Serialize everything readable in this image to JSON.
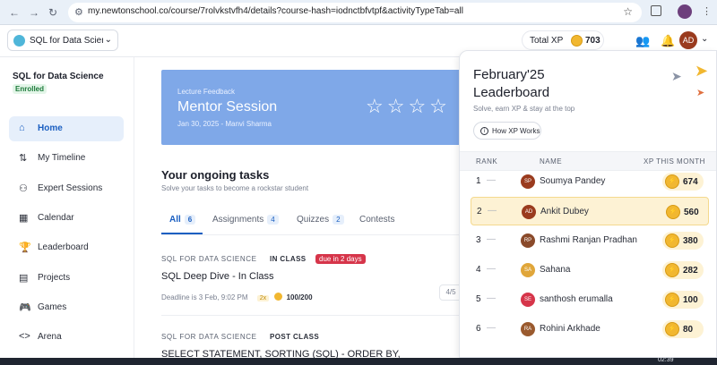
{
  "browser": {
    "url": "my.newtonschool.co/course/7rolvkstvfh4/details?course-hash=iodnctbfvtpf&activityTypeTab=all"
  },
  "header": {
    "course_select": "SQL for Data Scienc...",
    "total_xp_label": "Total XP",
    "total_xp_value": "703",
    "avatar_initials": "AD"
  },
  "sidebar": {
    "course_title": "SQL for Data Science",
    "status": "Enrolled",
    "items": [
      {
        "label": "Home",
        "icon": "home-icon"
      },
      {
        "label": "My Timeline",
        "icon": "timeline-icon"
      },
      {
        "label": "Expert Sessions",
        "icon": "people-icon"
      },
      {
        "label": "Calendar",
        "icon": "calendar-icon"
      },
      {
        "label": "Leaderboard",
        "icon": "trophy-icon"
      },
      {
        "label": "Projects",
        "icon": "document-icon"
      },
      {
        "label": "Games",
        "icon": "gamepad-icon"
      },
      {
        "label": "Arena",
        "icon": "code-icon"
      }
    ]
  },
  "banner": {
    "kicker": "Lecture Feedback",
    "title": "Mentor Session",
    "meta": "Jan 30, 2025 - Manvi Sharma"
  },
  "tasks": {
    "title": "Your ongoing tasks",
    "subtitle": "Solve your tasks to become a rockstar student",
    "tabs": [
      {
        "label": "All",
        "count": "6"
      },
      {
        "label": "Assignments",
        "count": "4"
      },
      {
        "label": "Quizzes",
        "count": "2"
      },
      {
        "label": "Contests",
        "count": ""
      }
    ],
    "items": [
      {
        "category": "SQL FOR DATA SCIENCE",
        "class_type": "IN CLASS",
        "due": "due in 2 days",
        "name": "SQL Deep Dive - In Class",
        "deadline": "Deadline is 3 Feb, 9:02 PM",
        "multiplier": "2x",
        "score": "100/200",
        "pager": "4/5"
      },
      {
        "category": "SQL FOR DATA SCIENCE",
        "class_type": "POST CLASS",
        "name": "SELECT STATEMENT, SORTING (SQL) - ORDER BY,"
      }
    ]
  },
  "leaderboard": {
    "title_line1": "February'25",
    "title_line2": "Leaderboard",
    "subtitle": "Solve, earn XP & stay at the top",
    "how_button": "How XP Works",
    "columns": {
      "rank": "RANK",
      "name": "NAME",
      "xp": "XP THIS MONTH"
    },
    "rows": [
      {
        "rank": "1",
        "initials": "SP",
        "name": "Soumya Pandey",
        "xp": "674",
        "avatar_color": "#9a3b1e"
      },
      {
        "rank": "2",
        "initials": "AD",
        "name": "Ankit Dubey",
        "xp": "560",
        "avatar_color": "#9a3b1e"
      },
      {
        "rank": "3",
        "initials": "RP",
        "name": "Rashmi Ranjan Pradhan",
        "xp": "380",
        "avatar_color": "#8a4a2a"
      },
      {
        "rank": "4",
        "initials": "SA",
        "name": "Sahana",
        "xp": "282",
        "avatar_color": "#e0a63a"
      },
      {
        "rank": "5",
        "initials": "SE",
        "name": "santhosh erumalla",
        "xp": "100",
        "avatar_color": "#d6354a"
      },
      {
        "rank": "6",
        "initials": "RA",
        "name": "Rohini Arkhade",
        "xp": "80",
        "avatar_color": "#9a5a2e"
      }
    ]
  },
  "taskbar": {
    "time": "02:39"
  },
  "colors": {
    "accent": "#1b5fc1",
    "banner": "#7fa8e8",
    "xp_gold": "#f1b730",
    "due_red": "#d6354a"
  }
}
